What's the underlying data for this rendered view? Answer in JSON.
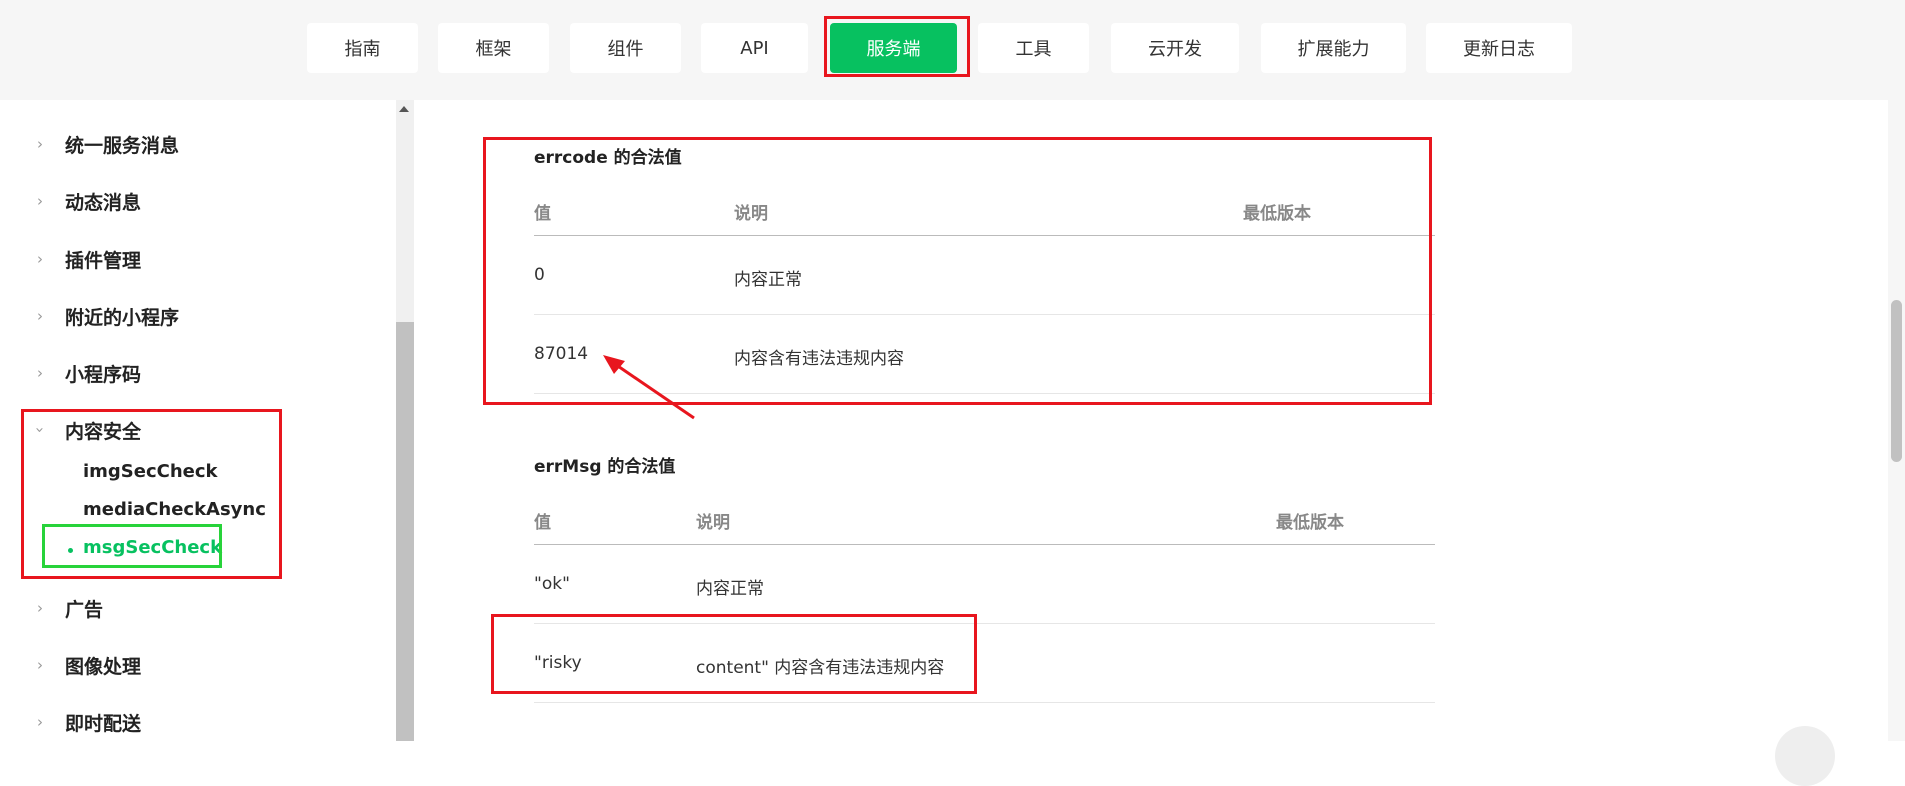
{
  "nav": {
    "tabs": [
      {
        "label": "指南"
      },
      {
        "label": "框架"
      },
      {
        "label": "组件"
      },
      {
        "label": "API"
      },
      {
        "label": "服务端",
        "active": true
      },
      {
        "label": "工具"
      },
      {
        "label": "云开发"
      },
      {
        "label": "扩展能力"
      },
      {
        "label": "更新日志"
      }
    ]
  },
  "sidebar": {
    "items": [
      {
        "label": "统一服务消息"
      },
      {
        "label": "动态消息"
      },
      {
        "label": "插件管理"
      },
      {
        "label": "附近的小程序"
      },
      {
        "label": "小程序码"
      },
      {
        "label": "内容安全",
        "expanded": true
      },
      {
        "label": "广告"
      },
      {
        "label": "图像处理"
      },
      {
        "label": "即时配送"
      }
    ],
    "sub_items": [
      {
        "label": "imgSecCheck"
      },
      {
        "label": "mediaCheckAsync"
      },
      {
        "label": "msgSecCheck",
        "active": true
      }
    ]
  },
  "errcode": {
    "title": "errcode 的合法值",
    "headers": [
      "值",
      "说明",
      "最低版本"
    ],
    "rows": [
      {
        "value": "0",
        "desc": "内容正常"
      },
      {
        "value": "87014",
        "desc": "内容含有违法违规内容"
      }
    ]
  },
  "errmsg": {
    "title": "errMsg 的合法值",
    "headers": [
      "值",
      "说明",
      "最低版本"
    ],
    "rows": [
      {
        "value": "\"ok\"",
        "desc": "内容正常"
      },
      {
        "value": "\"risky",
        "desc": "content\" 内容含有违法违规内容"
      }
    ]
  },
  "colors": {
    "accent": "#07c160",
    "annotation_red": "#e8161e",
    "annotation_green": "#28d33a"
  }
}
